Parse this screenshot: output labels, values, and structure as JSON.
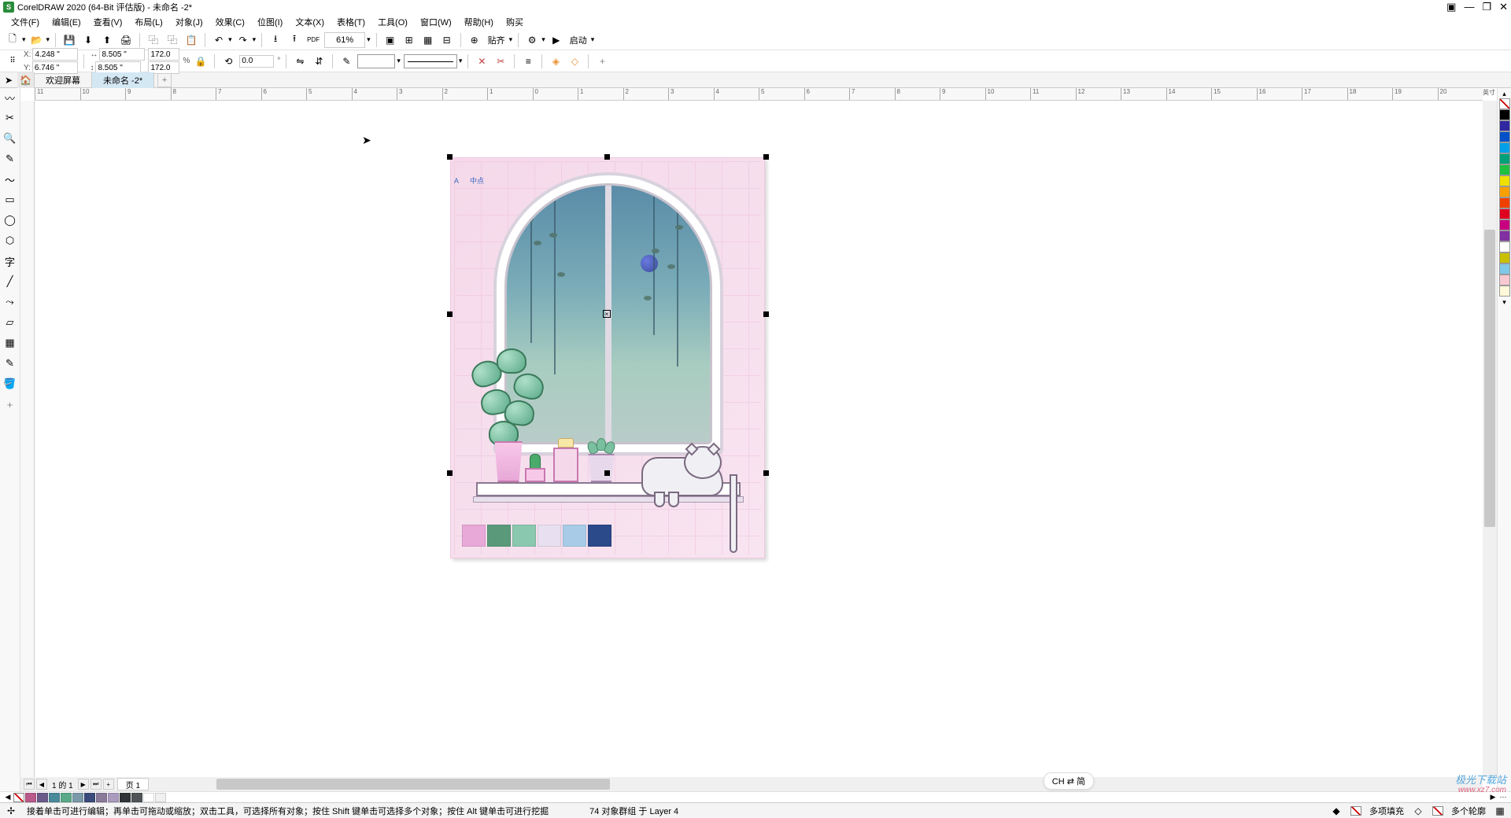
{
  "app": {
    "title": "CorelDRAW 2020 (64-Bit 评估版) - 未命名 -2*"
  },
  "menubar": {
    "file": "文件(F)",
    "edit": "编辑(E)",
    "view": "查看(V)",
    "layout": "布局(L)",
    "object": "对象(J)",
    "effects": "效果(C)",
    "bitmap": "位图(I)",
    "text": "文本(X)",
    "table": "表格(T)",
    "tools": "工具(O)",
    "window": "窗口(W)",
    "help": "帮助(H)",
    "buy": "购买"
  },
  "toolbar1": {
    "zoom": "61%",
    "pdf": "PDF",
    "paste_label": "贴齐",
    "launch_label": "启动"
  },
  "propbar": {
    "x_label": "X:",
    "x_value": "4.248 \"",
    "y_label": "Y:",
    "y_value": "6.746 \"",
    "w_value": "8.505 \"",
    "h_value": "8.505 \"",
    "sx_value": "172.0",
    "sy_value": "172.0",
    "percent": "%",
    "rotation": "0.0",
    "deg": "°"
  },
  "tabs": {
    "welcome": "欢迎屏幕",
    "doc1": "未命名 -2*"
  },
  "ruler": {
    "unit": "英寸",
    "h_ticks": [
      "11",
      "10",
      "9",
      "8",
      "7",
      "6",
      "5",
      "4",
      "3",
      "2",
      "1",
      "0",
      "1",
      "2",
      "3",
      "4",
      "5",
      "6",
      "7",
      "8",
      "9",
      "10",
      "11",
      "12",
      "13",
      "14",
      "15",
      "16",
      "17",
      "18",
      "19",
      "20"
    ]
  },
  "artwork": {
    "label_a": "A",
    "label_center": "中点",
    "palette": [
      "#e8a8d8",
      "#5a9a7a",
      "#8ac8b0",
      "#e8e0f0",
      "#a8cce8",
      "#2a4a8a"
    ]
  },
  "pagenav": {
    "pages_text": "1  的  1",
    "page_tab": "页 1",
    "plus": "+"
  },
  "colorstrip": [
    "#000000",
    "#3028a0",
    "#0050c8",
    "#00a0e8",
    "#00a078",
    "#20c040",
    "#f0e000",
    "#f8a000",
    "#f04000",
    "#e00020",
    "#c80080",
    "#8030a0",
    "#ffffff",
    "#c8c000",
    "#80c8e8",
    "#f8c8d0",
    "#fff8d8"
  ],
  "palette_row": [
    "#b85a8a",
    "#6a5a8a",
    "#4a8a9a",
    "#5aaa8a",
    "#7a9aaa",
    "#3a4a7a",
    "#8a7a9a",
    "#aa9abe",
    "#303438",
    "#505458",
    "#ffffff",
    "#f0f0f0"
  ],
  "statusbar": {
    "hint": "接着单击可进行编辑；再单击可拖动或缩放；双击工具，可选择所有对象；按住 Shift 键单击可选择多个对象；按住 Alt 键单击可进行挖掘",
    "selection": "74 对象群组 于 Layer 4",
    "fill_label": "多项填充",
    "outline_label": "多个轮廓"
  },
  "ime": "CH ⇄ 简",
  "watermark": {
    "name": "极光下载站",
    "url": "www.xz7.com"
  }
}
